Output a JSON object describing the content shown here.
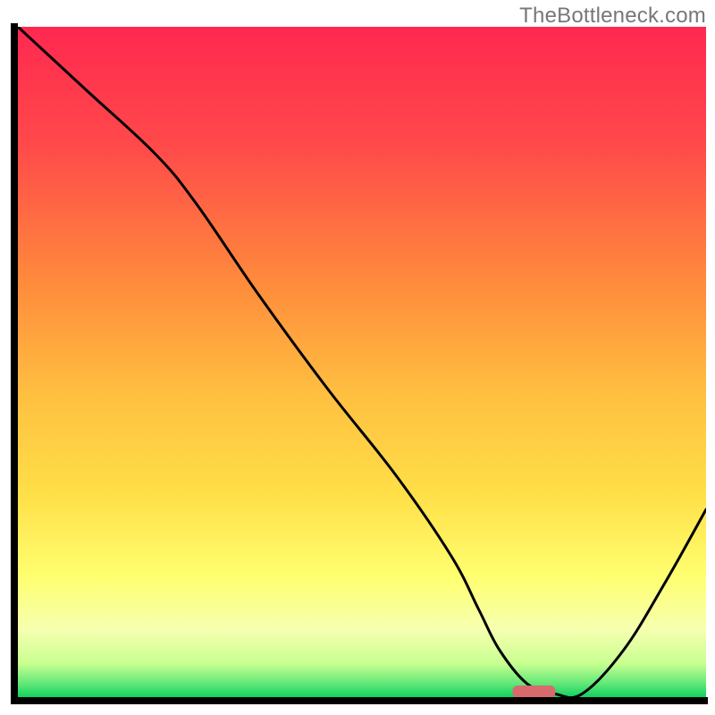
{
  "watermark": "TheBottleneck.com",
  "chart_data": {
    "type": "line",
    "title": "",
    "xlabel": "",
    "ylabel": "",
    "xlim": [
      0,
      100
    ],
    "ylim": [
      0,
      100
    ],
    "x": [
      0,
      10,
      20,
      26,
      35,
      45,
      55,
      63,
      67,
      70,
      74,
      78,
      82,
      88,
      94,
      100
    ],
    "values": [
      100,
      90.5,
      81,
      73.5,
      60,
      46,
      33,
      21,
      13,
      7,
      2,
      0.5,
      0.5,
      7,
      17,
      28
    ],
    "marker": {
      "x": 75,
      "y": 0.8,
      "color": "#d86a6d"
    },
    "colors": {
      "top": "#ff2850",
      "mid_upper": "#ff7a3c",
      "mid": "#ffd040",
      "mid_lower": "#ffff60",
      "low": "#f8ffb0",
      "bottom": "#10d060"
    }
  }
}
